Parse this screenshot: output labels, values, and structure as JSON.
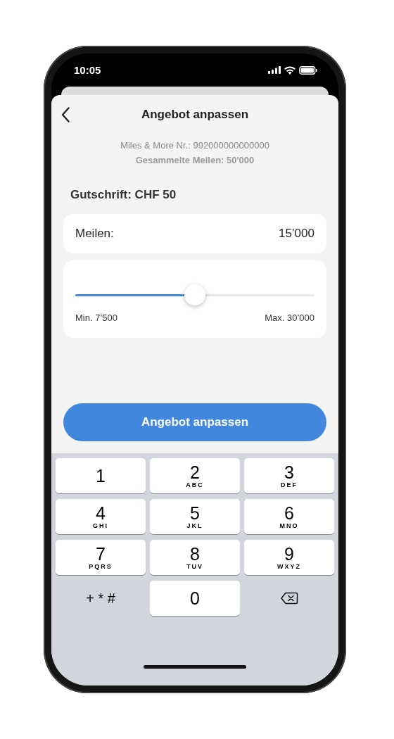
{
  "status_bar": {
    "time": "10:05"
  },
  "header": {
    "title": "Angebot anpassen"
  },
  "info": [
    "Miles & More Nr.: 992000000000000",
    "Gesammelte Meilen: 50'000"
  ],
  "credit": "Gutschrift: CHF 50",
  "miles_field": {
    "label": "Meilen:",
    "value": "15’000"
  },
  "slider": {
    "level": 0.5,
    "min_label": "Min. 7’500",
    "max_label": "Max. 30’000"
  },
  "button": "Angebot anpassen",
  "keypad": [
    {
      "kind": "digit",
      "digit": "1"
    },
    {
      "kind": "digit",
      "digit": "2",
      "letters": "ABC"
    },
    {
      "kind": "digit",
      "digit": "3",
      "letters": "DEF"
    },
    {
      "kind": "digit",
      "digit": "4",
      "letters": "GHI"
    },
    {
      "kind": "digit",
      "digit": "5",
      "letters": "JKL"
    },
    {
      "kind": "digit",
      "digit": "6",
      "letters": "MNO"
    },
    {
      "kind": "digit",
      "digit": "7",
      "letters": "PQRS"
    },
    {
      "kind": "digit",
      "digit": "8",
      "letters": "TUV"
    },
    {
      "kind": "digit",
      "digit": "9",
      "letters": "WXYZ"
    },
    {
      "kind": "symbols",
      "label": "+ * #"
    },
    {
      "kind": "digit",
      "digit": "0"
    },
    {
      "kind": "delete"
    }
  ]
}
